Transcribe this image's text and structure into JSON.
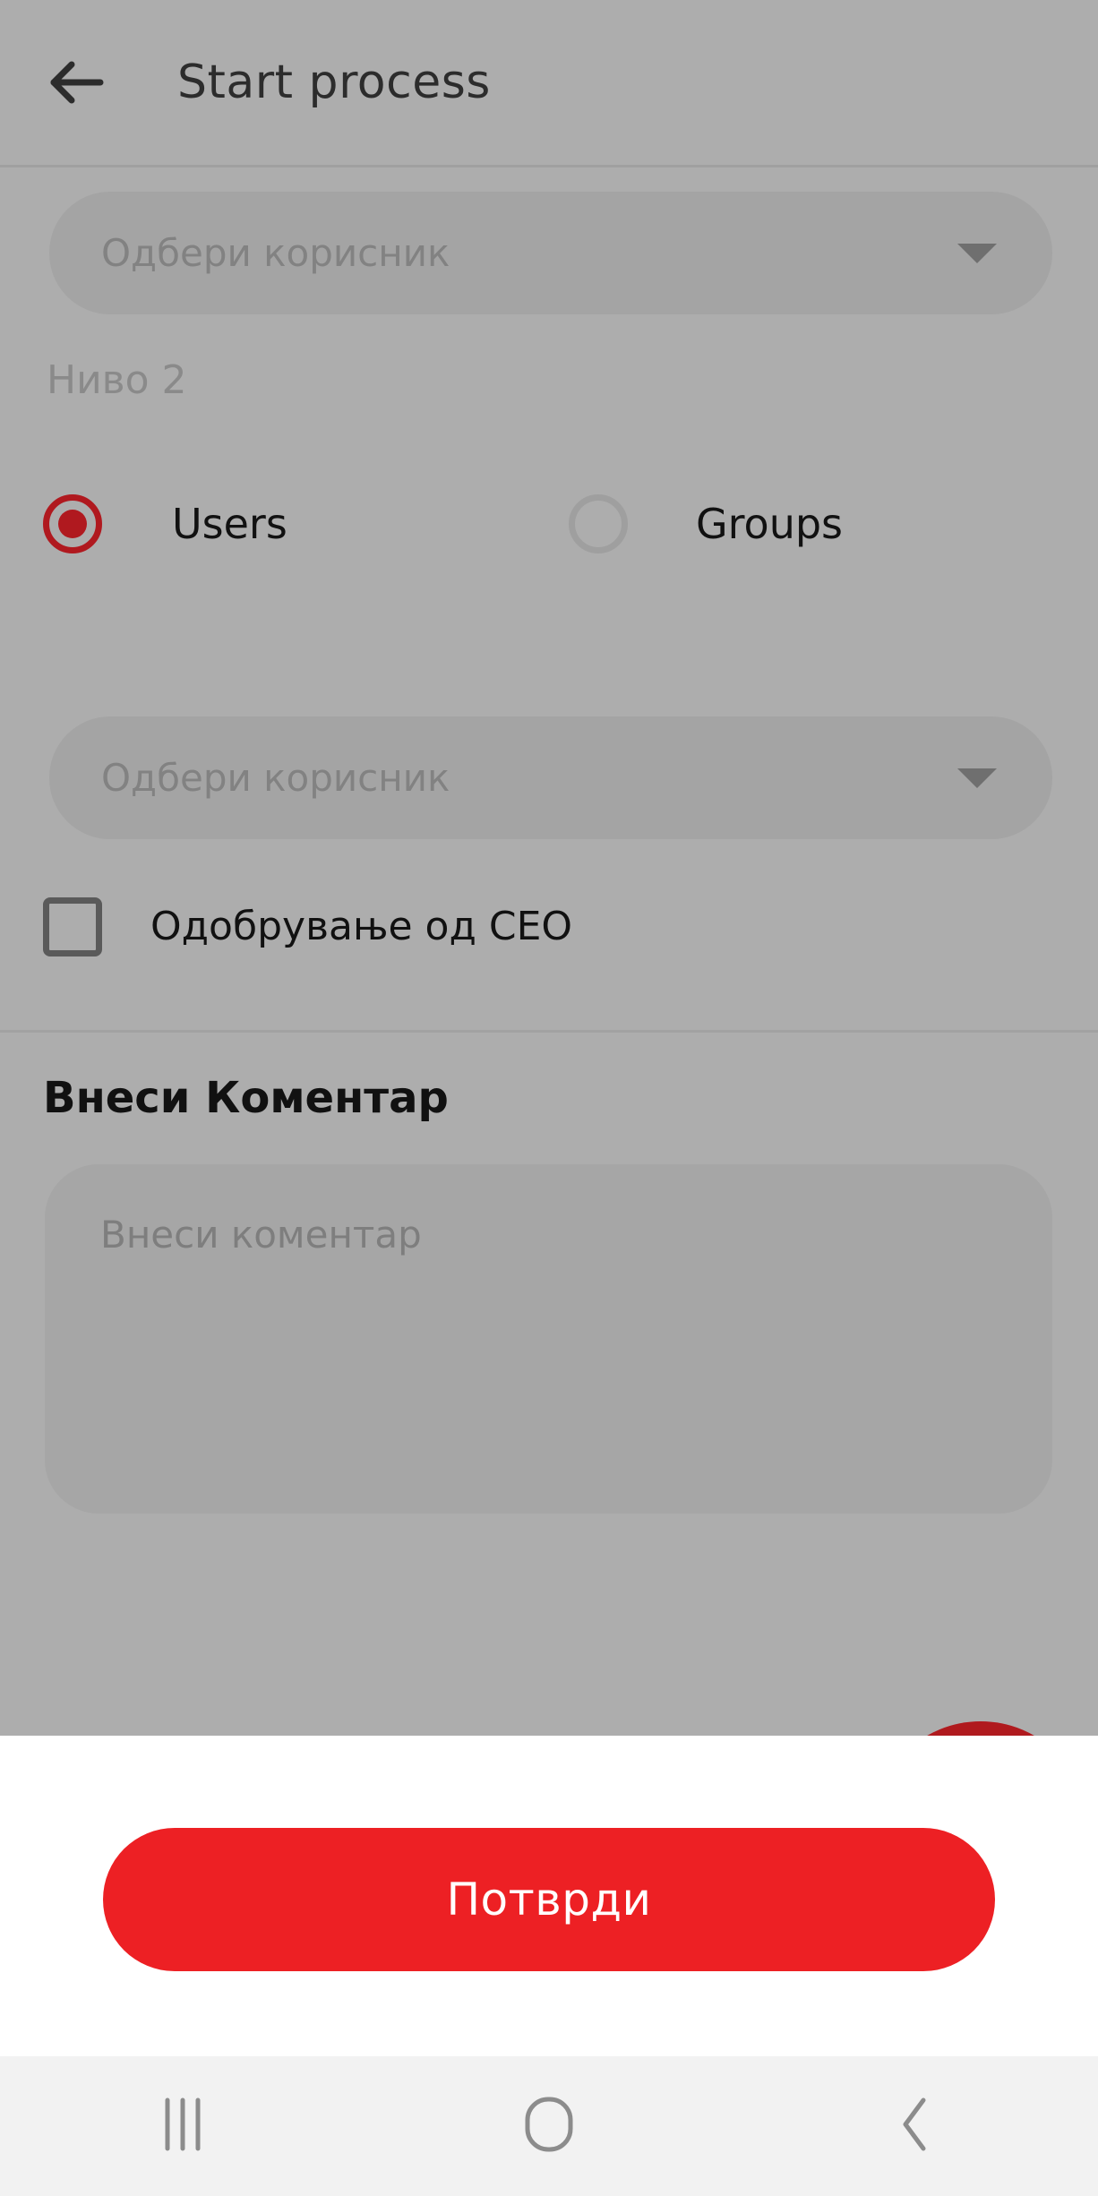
{
  "header": {
    "title": "Start process",
    "back_icon": "arrow-left-icon"
  },
  "form": {
    "dropdown_1": {
      "placeholder": "Одбери корисник",
      "value": "",
      "caret_icon": "chevron-down-icon"
    },
    "level_label": "Ниво 2",
    "radio_group": {
      "selected": "Users",
      "options": [
        {
          "label": "Users",
          "checked": true
        },
        {
          "label": "Groups",
          "checked": false
        }
      ]
    },
    "dropdown_2": {
      "placeholder": "Одбери корисник",
      "value": "",
      "caret_icon": "chevron-down-icon"
    },
    "checkbox": {
      "label": "Одобрување од CEO",
      "checked": false
    }
  },
  "comment": {
    "heading": "Внеси Коментар",
    "placeholder": "Внеси коментар",
    "value": ""
  },
  "fab": {
    "icon": "arrow-right-icon"
  },
  "bottom": {
    "confirm_label": "Потврди"
  },
  "nav_bar": {
    "recents_icon": "recents-icon",
    "home_icon": "home-icon",
    "back_icon": "back-chevron-icon"
  },
  "colors": {
    "scrim_gray": "#adadad",
    "field_gray": "#a4a4a4",
    "accent_red": "#ed2024",
    "accent_red_dim": "#b01a1e",
    "text_dark": "#111111",
    "placeholder_gray": "#828282",
    "nav_bar_bg": "#f2f2f2"
  }
}
